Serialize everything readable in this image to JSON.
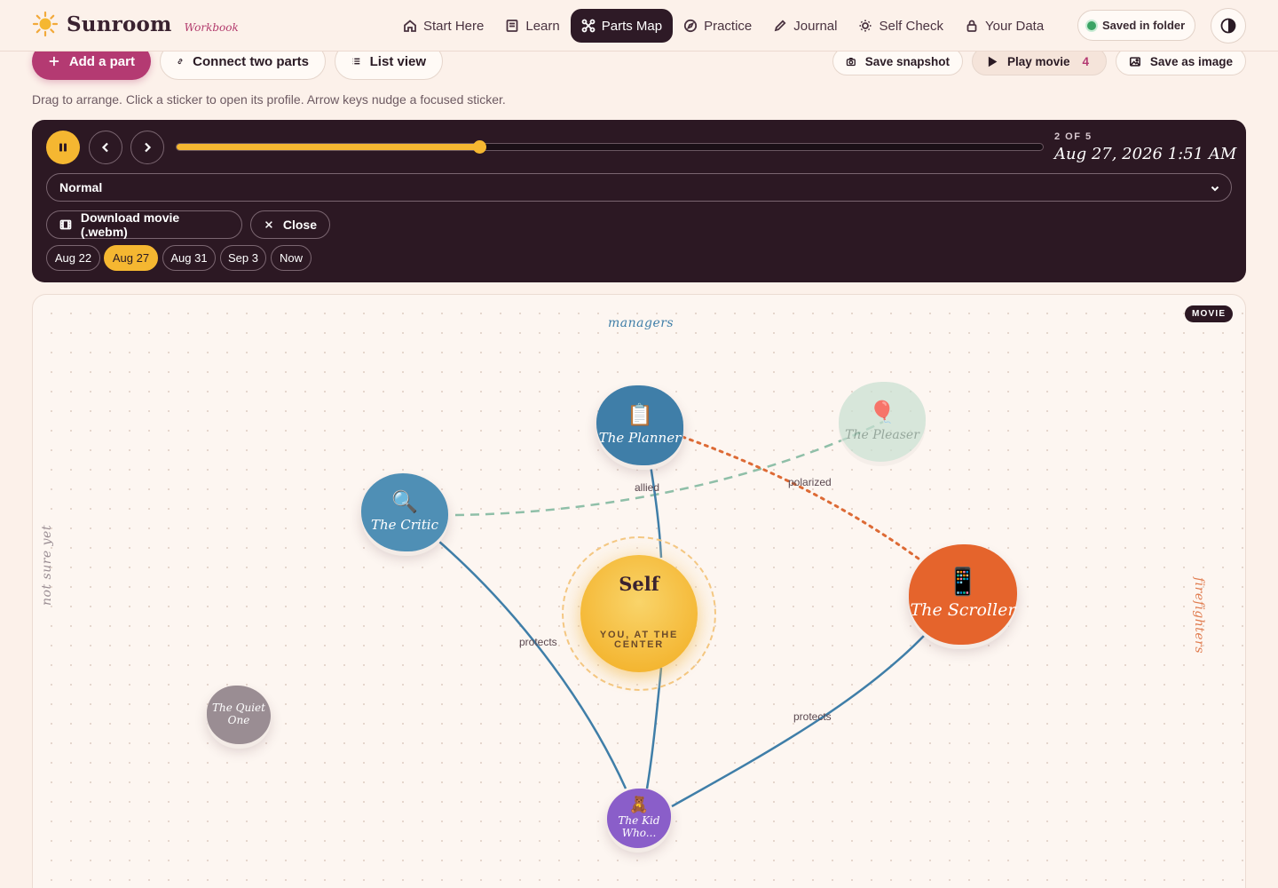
{
  "brand": {
    "name": "Sunroom",
    "tag": "Workbook"
  },
  "nav": [
    {
      "label": "Start Here",
      "icon": "home-icon",
      "active": false
    },
    {
      "label": "Learn",
      "icon": "book-icon",
      "active": false
    },
    {
      "label": "Parts Map",
      "icon": "network-icon",
      "active": true
    },
    {
      "label": "Practice",
      "icon": "compass-icon",
      "active": false
    },
    {
      "label": "Journal",
      "icon": "pencil-icon",
      "active": false
    },
    {
      "label": "Self Check",
      "icon": "sun-icon",
      "active": false
    },
    {
      "label": "Your Data",
      "icon": "lock-icon",
      "active": false
    }
  ],
  "saved_status": "Saved in folder",
  "toolbar": {
    "add_part": "Add a part",
    "connect": "Connect two parts",
    "list_view": "List view",
    "save_snapshot": "Save snapshot",
    "play_movie": "Play movie",
    "play_movie_count": "4",
    "save_image": "Save as image"
  },
  "hint": "Drag to arrange. Click a sticker to open its profile. Arrow keys nudge a focused sticker.",
  "movie": {
    "step_label": "2 OF 5",
    "date": "Aug 27, 2026 1:51 AM",
    "progress": 0.35,
    "speed": "Normal",
    "download_label": "Download movie (.webm)",
    "close_label": "Close",
    "chips": [
      {
        "label": "Aug 22",
        "active": false
      },
      {
        "label": "Aug 27",
        "active": true
      },
      {
        "label": "Aug 31",
        "active": false
      },
      {
        "label": "Sep 3",
        "active": false
      },
      {
        "label": "Now",
        "active": false
      }
    ]
  },
  "canvas": {
    "badge": "MOVIE",
    "zones": {
      "managers": "managers",
      "not_sure": "not sure yet",
      "firefighters": "firefighters"
    },
    "self": {
      "title": "Self",
      "subtitle": "YOU, AT THE CENTER"
    },
    "parts": [
      {
        "id": "planner",
        "name": "The Planner",
        "emoji": "📋",
        "color": "#3f7ea8"
      },
      {
        "id": "pleaser",
        "name": "The Pleaser",
        "emoji": "🎈",
        "color": "#c9e0d2"
      },
      {
        "id": "critic",
        "name": "The Critic",
        "emoji": "🔍",
        "color": "#4f8fb5"
      },
      {
        "id": "scroller",
        "name": "The Scroller",
        "emoji": "📱",
        "color": "#e5642c"
      },
      {
        "id": "quiet",
        "name": "The Quiet One",
        "emoji": "",
        "color": "#9a8d93"
      },
      {
        "id": "kid",
        "name": "The Kid Who...",
        "emoji": "🧸",
        "color": "#8a5ec9"
      }
    ],
    "edge_labels": {
      "allied": "allied",
      "polarized": "polarized",
      "protects_a": "protects",
      "protects_b": "protects"
    }
  }
}
